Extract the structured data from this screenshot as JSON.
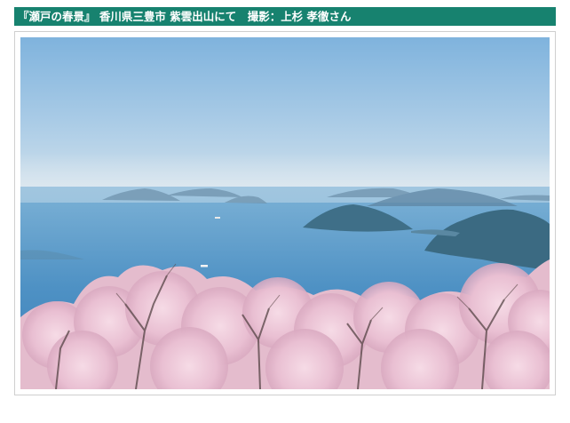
{
  "caption": {
    "text": "『瀬戸の春景』 香川県三豊市 紫雲出山にて　撮影：上杉 孝徹さん"
  },
  "photo": {
    "subject": "Seto Inland Sea islands viewed through cherry blossoms"
  },
  "colors": {
    "title_bar": "#17826f",
    "frame_border": "#cfcfcf"
  }
}
